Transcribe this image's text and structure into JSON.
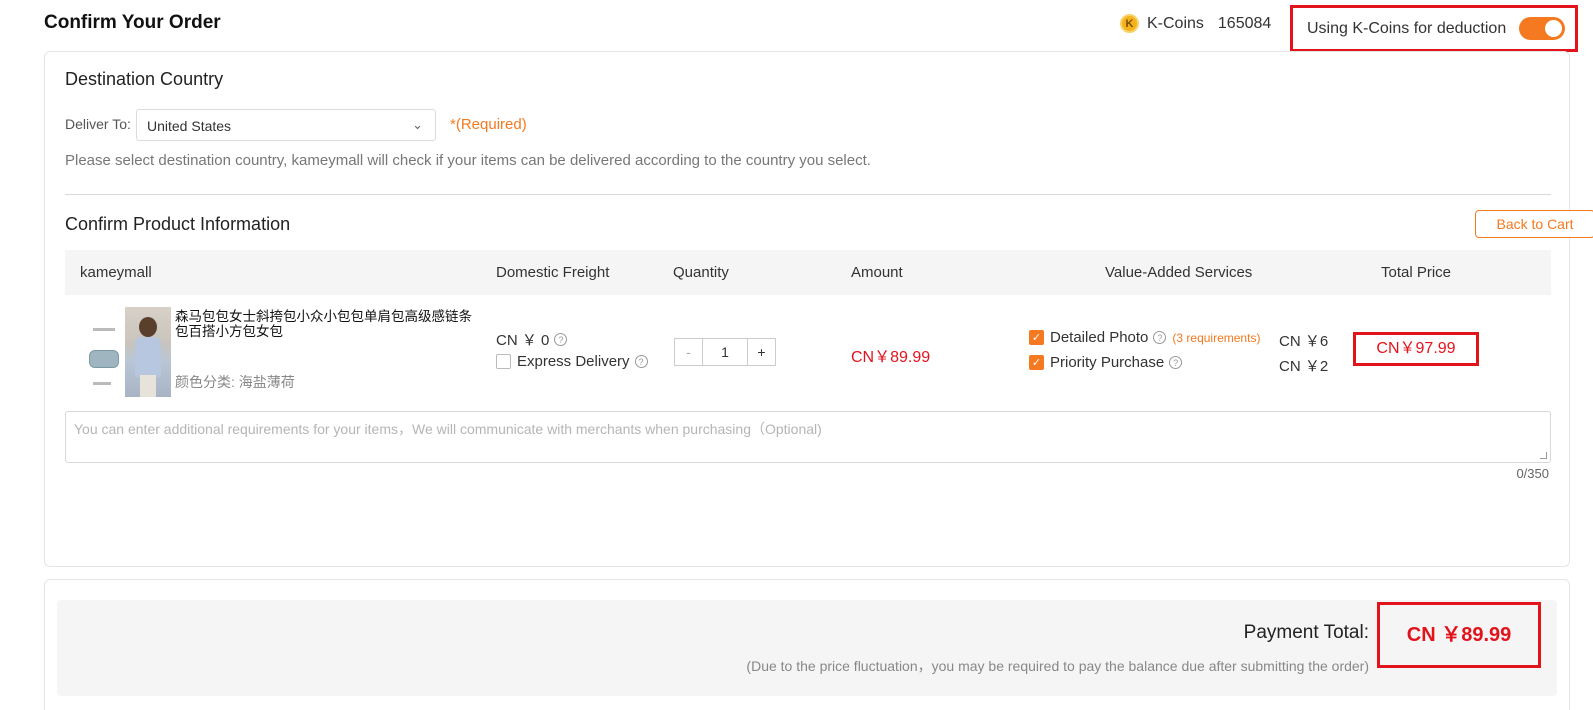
{
  "header": {
    "title": "Confirm Your Order",
    "kcoins_label": "K-Coins",
    "kcoins_icon_letter": "K",
    "kcoins_balance": "165084",
    "deduction_label": "Using K-Coins for deduction",
    "deduction_enabled": true
  },
  "destination": {
    "title": "Destination Country",
    "deliver_label": "Deliver To:",
    "selected_country": "United States",
    "required_text": "*(Required)",
    "hint": "Please select destination country, kameymall will check if your items can be delivered according to the country you select."
  },
  "product_section": {
    "title": "Confirm Product Information",
    "back_button": "Back to Cart",
    "columns": [
      "kameymall",
      "Domestic Freight",
      "Quantity",
      "Amount",
      "Value-Added Services",
      "Total Price"
    ],
    "item": {
      "name": "森马包包女士斜挎包小众小包包单肩包高级感链条包百搭小方包女包",
      "variant": "颜色分类: 海盐薄荷",
      "freight": "CN ￥ 0",
      "express_label": "Express Delivery",
      "quantity": "1",
      "qty_minus": "-",
      "qty_plus": "+",
      "amount": "CN￥89.99",
      "services": [
        {
          "label": "Detailed Photo",
          "note": "(3 requirements)",
          "price": "CN ￥6",
          "checked": true
        },
        {
          "label": "Priority Purchase",
          "note": "",
          "price": "CN ￥2",
          "checked": true
        }
      ],
      "total": "CN￥97.99"
    },
    "notes_placeholder": "You can enter additional requirements for your items，We will communicate with merchants when purchasing（Optional)",
    "notes_counter": "0/350"
  },
  "payment": {
    "label": "Payment Total:",
    "total": "CN ￥89.99",
    "note": "(Due to the price fluctuation，you may be required to pay the balance due after submitting the order)"
  },
  "colors": {
    "accent": "#f47920",
    "price_red": "#e3131c",
    "highlight_border": "#e3131c"
  }
}
